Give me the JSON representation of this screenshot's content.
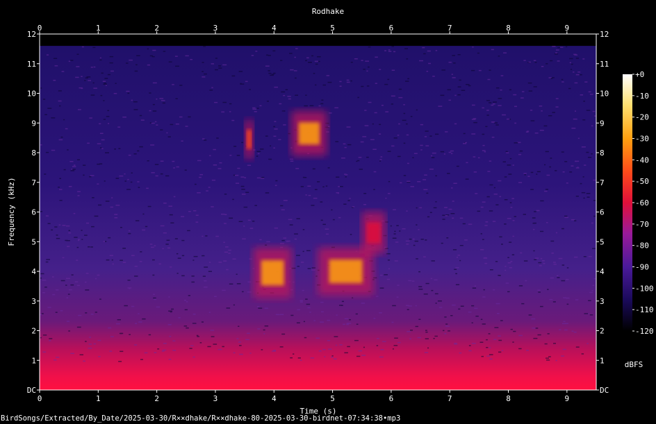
{
  "chart_data": {
    "type": "heatmap",
    "title": "Rodhake",
    "xlabel": "Time (s)",
    "ylabel": "Frequency (kHz)",
    "xlim": [
      0,
      9.5
    ],
    "ylim": [
      0,
      12
    ],
    "x_ticks": [
      "0",
      "1",
      "2",
      "3",
      "4",
      "5",
      "6",
      "7",
      "8",
      "9"
    ],
    "y_ticks": [
      "DC",
      "1",
      "2",
      "3",
      "4",
      "5",
      "6",
      "7",
      "8",
      "9",
      "10",
      "11",
      "12"
    ],
    "colorbar": {
      "label": "dBFS",
      "range": [
        -120,
        0
      ],
      "ticks": [
        "+0",
        "-10",
        "-20",
        "-30",
        "-40",
        "-50",
        "-60",
        "-70",
        "-80",
        "-90",
        "-100",
        "-110",
        "-120"
      ],
      "colors": [
        "#000000",
        "#1a0a5a",
        "#4a1a9a",
        "#9a1a9a",
        "#e0103a",
        "#ff4a1a",
        "#ffa010",
        "#ffe070",
        "#ffffff"
      ]
    },
    "background_cutoff_khz": 11.6,
    "calls": [
      {
        "t_start": 3.5,
        "t_end": 3.65,
        "f_low": 7.8,
        "f_high": 9.1,
        "level_db": -40
      },
      {
        "t_start": 4.3,
        "t_end": 4.9,
        "f_low": 7.9,
        "f_high": 9.4,
        "level_db": -30
      },
      {
        "t_start": 3.65,
        "t_end": 4.3,
        "f_low": 3.1,
        "f_high": 4.8,
        "level_db": -35
      },
      {
        "t_start": 4.75,
        "t_end": 5.7,
        "f_low": 3.2,
        "f_high": 4.8,
        "level_db": -35
      },
      {
        "t_start": 5.5,
        "t_end": 5.9,
        "f_low": 4.6,
        "f_high": 6.0,
        "level_db": -55
      }
    ]
  },
  "footer": "BirdSongs/Extracted/By_Date/2025-03-30/R××dhake/R××dhake-80-2025-03-30-birdnet-07:34:38•mp3"
}
